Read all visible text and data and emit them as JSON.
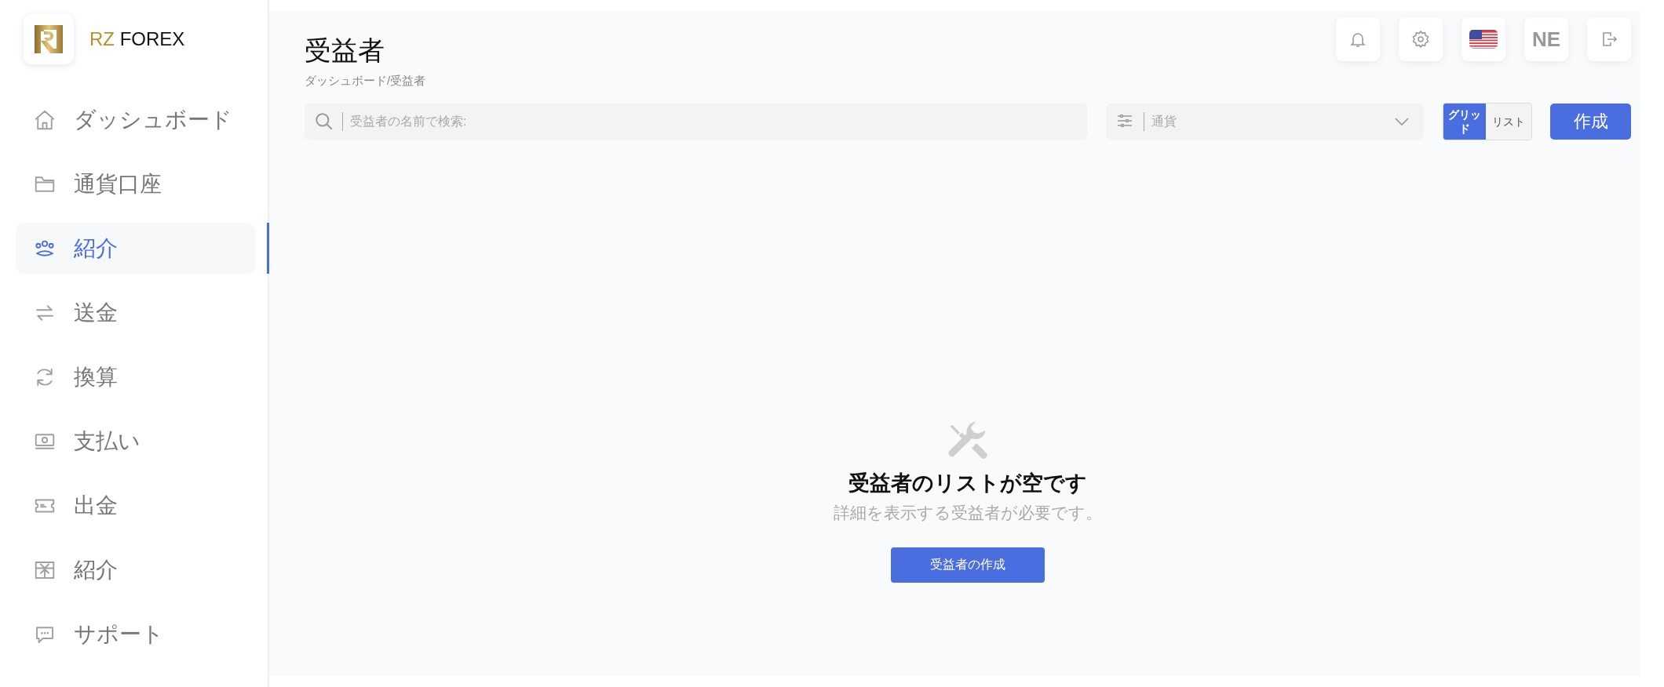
{
  "logo": {
    "brand_prefix": "RZ",
    "brand_name": "FOREX"
  },
  "sidebar": {
    "items": [
      {
        "label": "ダッシュボード",
        "kind": "home",
        "selected": false
      },
      {
        "label": "通貨口座",
        "kind": "folder",
        "selected": false
      },
      {
        "label": "紹介",
        "kind": "people",
        "selected": true
      },
      {
        "label": "送金",
        "kind": "arrows",
        "selected": false
      },
      {
        "label": "換算",
        "kind": "refresh",
        "selected": false
      },
      {
        "label": "支払い",
        "kind": "cash",
        "selected": false
      },
      {
        "label": "出金",
        "kind": "ticket",
        "selected": false
      },
      {
        "label": "紹介",
        "kind": "gift",
        "selected": false
      },
      {
        "label": "サポート",
        "kind": "chat",
        "selected": false
      }
    ]
  },
  "header": {
    "title": "受益者",
    "breadcrumb": "ダッシュボード/受益者",
    "buttons": [
      {
        "kind": "bell"
      },
      {
        "kind": "gear"
      },
      {
        "kind": "flag"
      },
      {
        "kind": "text",
        "label": "NE"
      },
      {
        "kind": "logout"
      }
    ]
  },
  "toolbar": {
    "search": {
      "placeholder": "受益者の名前で検索:"
    },
    "currency": {
      "placeholder": "通貨"
    },
    "view_toggle": [
      {
        "label": "グリッド",
        "selected": true
      },
      {
        "label": "リスト",
        "selected": false
      }
    ],
    "create_button": "作成"
  },
  "empty_state": {
    "title": "受益者のリストが空です",
    "message": "詳細を表示する受益者が必要です。",
    "button": "受益者の作成"
  }
}
